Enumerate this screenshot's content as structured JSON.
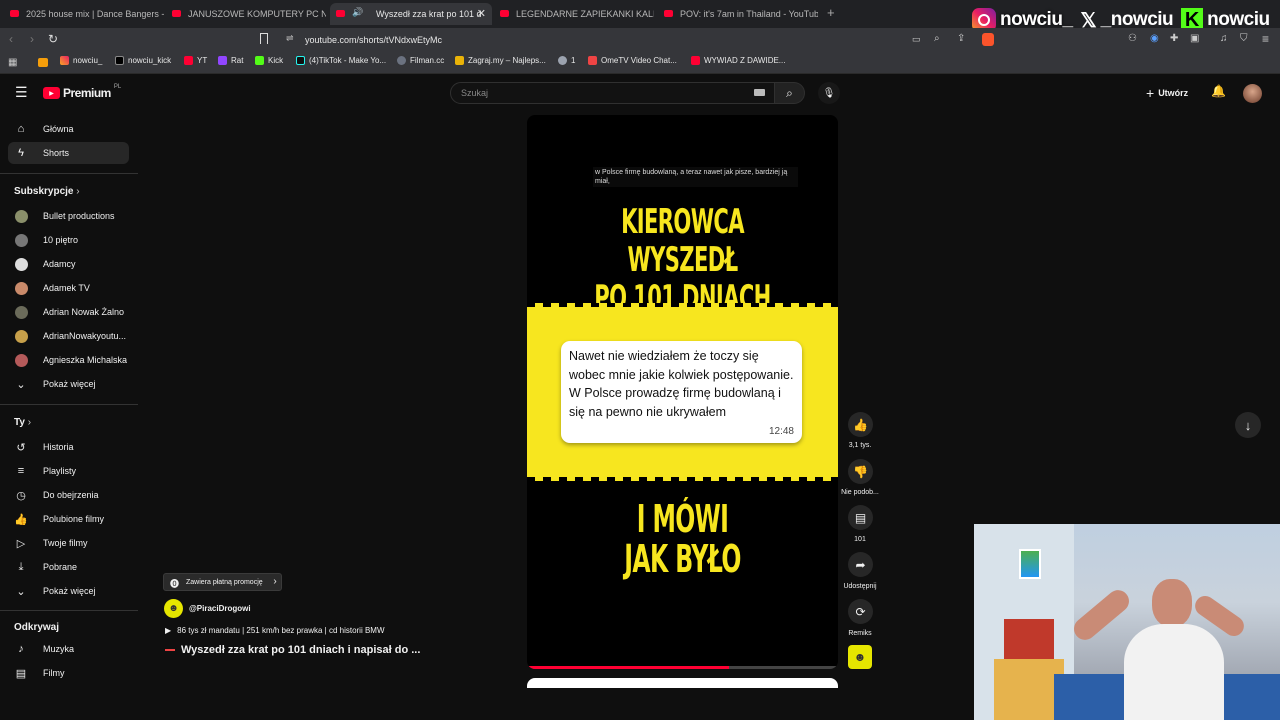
{
  "browser": {
    "tabs": [
      {
        "title": "2025 house mix | Dance Bangers - Yo"
      },
      {
        "title": "JANUSZOWE KOMPUTERY PC Niem"
      },
      {
        "title": "Wyszedł zza krat po 101 d"
      },
      {
        "title": "LEGENDARNE ZAPIEKANKI KALISKA"
      },
      {
        "title": "POV: it's 7am in Thailand - YouTube"
      }
    ],
    "new_tab": "+",
    "url": "youtube.com/shorts/tVNdxwEtyMc",
    "bookmarks": [
      "nowciu_",
      "nowciu_kick",
      "YT",
      "Rat",
      "Kick",
      "(4)TikTok - Make Yo...",
      "Filman.cc",
      "Zagraj.my – Najleps...",
      "1",
      "OmeTV Video Chat...",
      "WYWIAD Z DAWIDE..."
    ]
  },
  "overlay": {
    "instagram": "nowciu_",
    "x": "_nowciu",
    "kick": "nowciu"
  },
  "header": {
    "logo": "Premium",
    "logo_region": "PL",
    "search_placeholder": "Szukaj",
    "create_label": "Utwórz"
  },
  "sidebar": {
    "main": [
      {
        "label": "Główna"
      },
      {
        "label": "Shorts"
      }
    ],
    "subs_title": "Subskrypcje",
    "subs": [
      {
        "label": "Bullet productions"
      },
      {
        "label": "10 piętro"
      },
      {
        "label": "Adamcy"
      },
      {
        "label": "Adamek TV"
      },
      {
        "label": "Adrian Nowak Żalno"
      },
      {
        "label": "AdrianNowakyoutu..."
      },
      {
        "label": "Agnieszka Michalska"
      }
    ],
    "subs_more": "Pokaż więcej",
    "you_title": "Ty",
    "you": [
      {
        "label": "Historia"
      },
      {
        "label": "Playlisty"
      },
      {
        "label": "Do obejrzenia"
      },
      {
        "label": "Polubione filmy"
      },
      {
        "label": "Twoje filmy"
      },
      {
        "label": "Pobrane"
      },
      {
        "label": "Pokaż więcej"
      }
    ],
    "explore_title": "Odkrywaj",
    "explore": [
      {
        "label": "Muzyka"
      },
      {
        "label": "Filmy"
      }
    ]
  },
  "short": {
    "caption": "w Polsce firmę budowlaną, a teraz nawet jak pisze, bardziej ją miał,",
    "headline_1": "KIEROWCA WYSZEDŁ",
    "headline_2": "PO 101 DNIACH",
    "message": "Nawet nie wiedziałem że toczy się wobec mnie jakie kolwiek postępowanie. W Polsce prowadzę firmę budowlaną i się na pewno nie ukrywałem",
    "message_time": "12:48",
    "bottom_1": "I MÓWI",
    "bottom_2": "JAK BYŁO",
    "promo": "Zawiera płatną promocję",
    "channel": "@PiraciDrogowi",
    "music": "86 tys zł mandatu | 251 km/h bez prawka | cd historii BMW",
    "title": "Wyszedł zza krat po 101 dniach i napisał do ...",
    "progress": 0.65
  },
  "actions": {
    "like": "3,1 tys.",
    "dislike": "Nie podob...",
    "comments": "101",
    "share": "Udostępnij",
    "remix": "Remiks"
  }
}
